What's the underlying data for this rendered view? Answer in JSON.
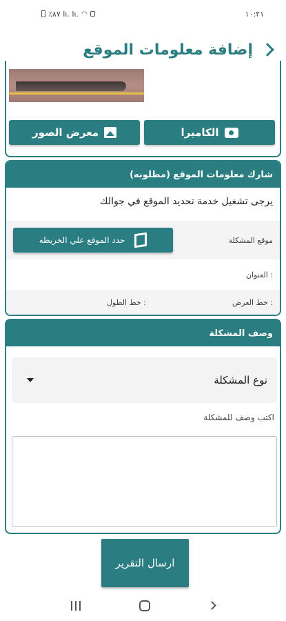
{
  "status_bar": {
    "time": "١٠:٢١",
    "indicators": "٪٨٧ lı. lı.",
    "icons": [
      "battery-icon",
      "signal-icon",
      "signal-icon",
      "wifi-icon",
      "lock-icon"
    ]
  },
  "header": {
    "title": "إضافة معلومات الموقع",
    "back_icon": "chevron-right-icon"
  },
  "photo": {
    "camera_label": "الكاميرا",
    "gallery_label": "معرض الصور",
    "camera_icon": "camera-icon",
    "gallery_icon": "image-icon"
  },
  "location": {
    "header": "شارك معلومات الموقع  (مطلوبه)",
    "hint": "يرجى تشغيل خدمة تحديد الموقع في جوالك",
    "problem_location_label": "موقع المشكلة",
    "map_button_label": "حدد الموقع علي الخريطه",
    "map_icon": "map-icon",
    "address_label": "العنوان :",
    "latitude_label": "خط العرض :",
    "longitude_label": "خط الطول :"
  },
  "description": {
    "header": "وصف المشكلة",
    "problem_type_value": "نوع المشكلة",
    "description_label": "اكتب وصف للمشكلة",
    "description_value": ""
  },
  "submit": {
    "label": "ارسال التقرير"
  },
  "colors": {
    "primary": "#2a7d80"
  }
}
